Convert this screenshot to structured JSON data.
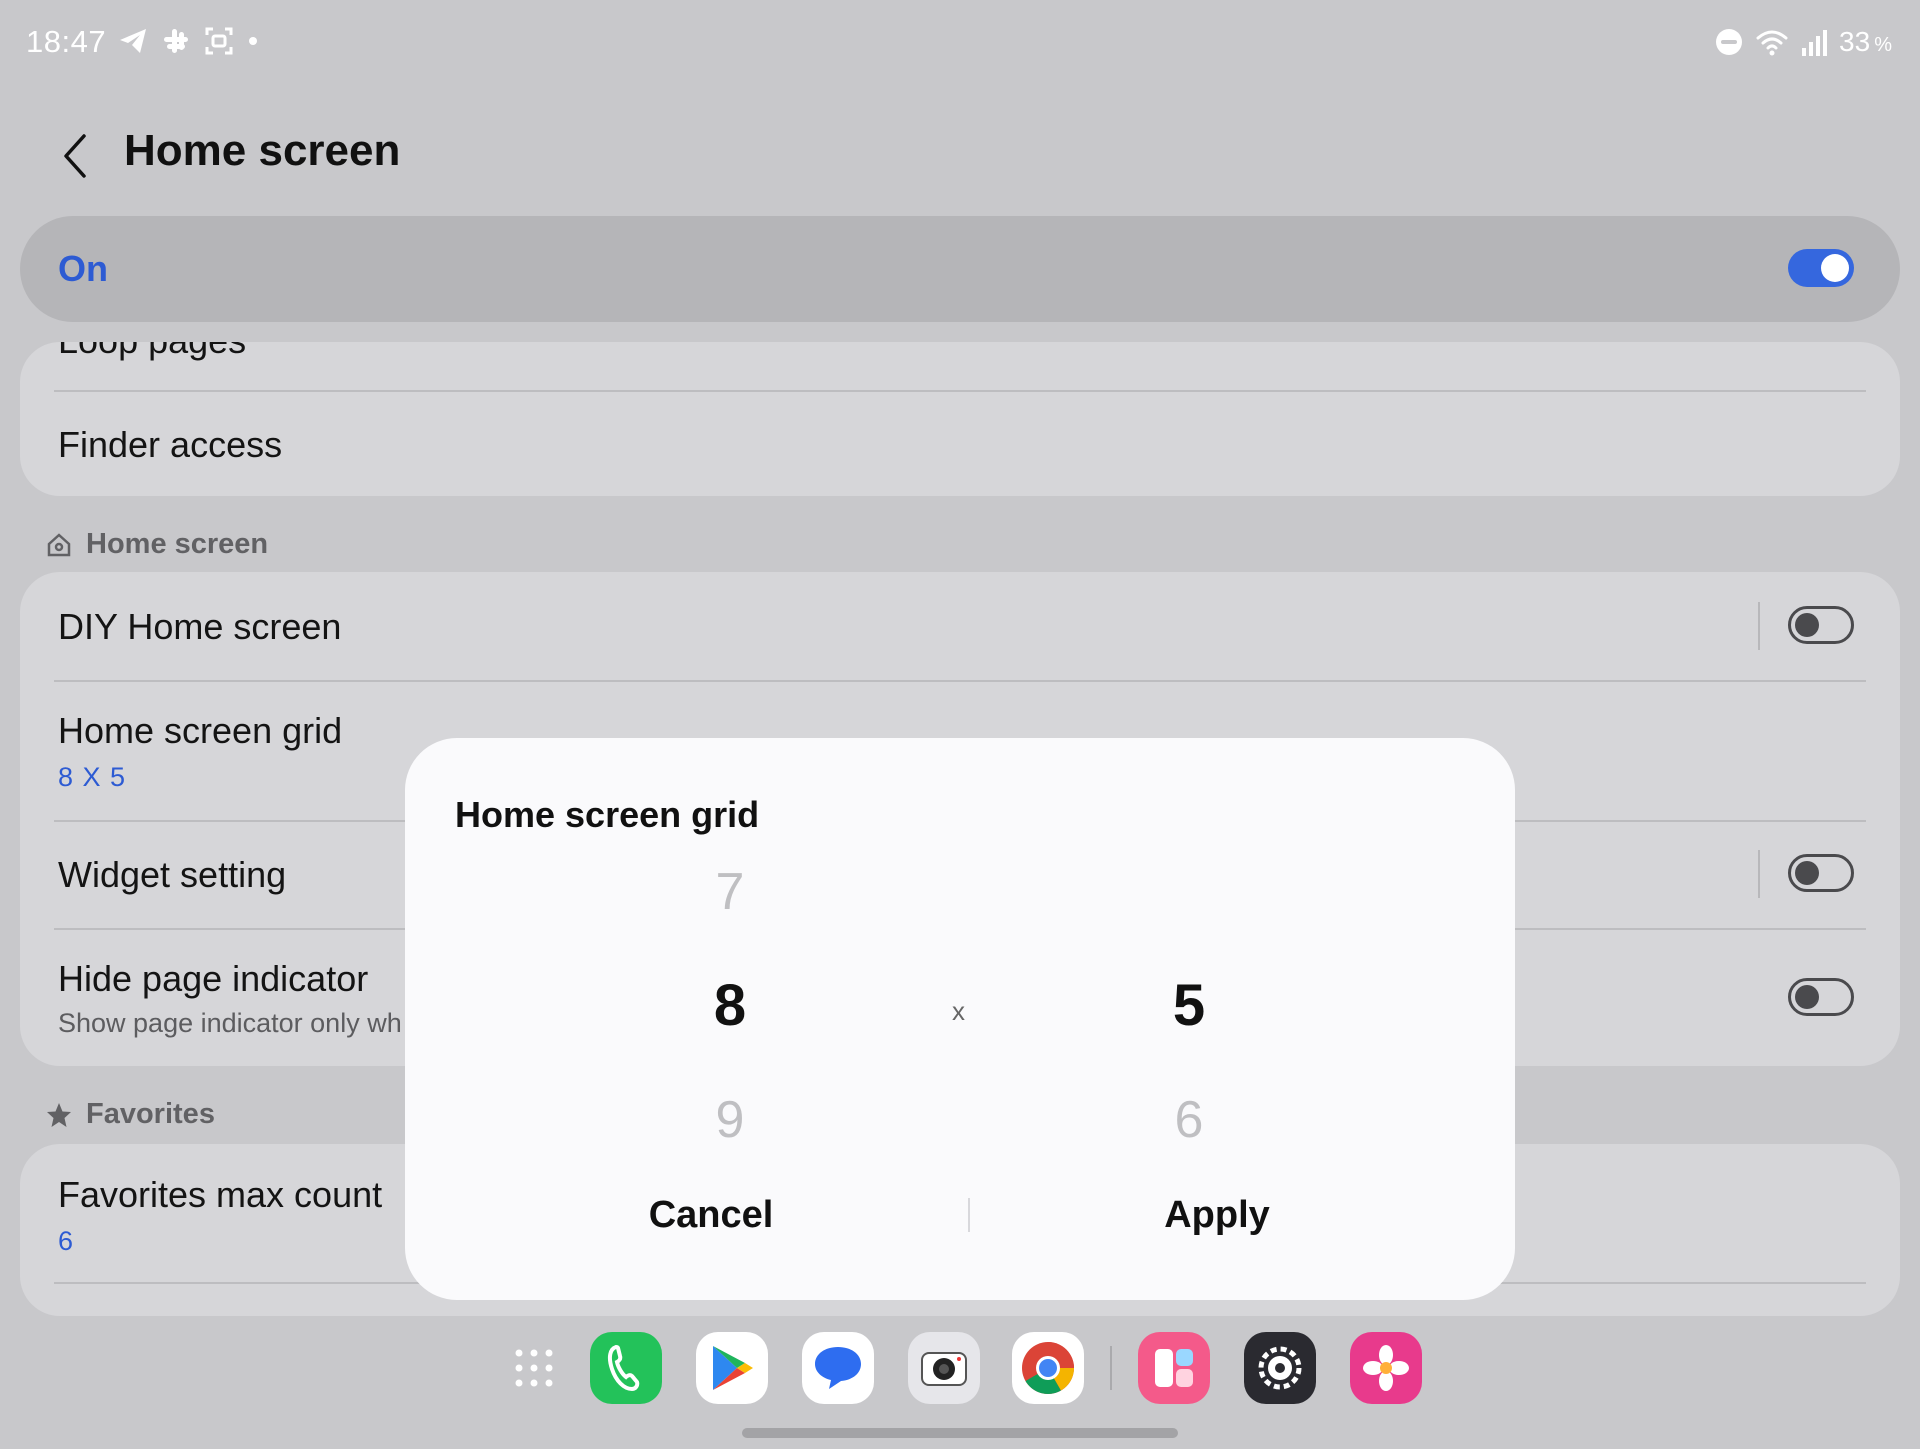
{
  "status_bar": {
    "time": "18:47",
    "battery": "33",
    "battery_unit": "%",
    "icons": [
      "telegram-icon",
      "slack-icon",
      "screenshot-icon",
      "dot-icon",
      "dnd-icon",
      "wifi-icon",
      "signal-icon"
    ]
  },
  "header": {
    "title": "Home screen"
  },
  "master": {
    "label": "On",
    "enabled": true
  },
  "group1": {
    "partial_item": "Loop pages",
    "finder": "Finder access"
  },
  "section_home": {
    "title": "Home screen"
  },
  "home_items": {
    "diy": "DIY Home screen",
    "grid_label": "Home screen grid",
    "grid_value": "8 X 5",
    "widget": "Widget setting",
    "hide_indicator": "Hide page indicator",
    "hide_indicator_desc": "Show page indicator only wh"
  },
  "section_favorites": {
    "title": "Favorites"
  },
  "favorites": {
    "max_label": "Favorites max count",
    "max_value": "6"
  },
  "dialog": {
    "title": "Home screen grid",
    "rows": {
      "prev": "7",
      "selected": "8",
      "next": "9"
    },
    "separator": "x",
    "cols": {
      "prev": "",
      "selected": "5",
      "next": "6"
    },
    "cancel": "Cancel",
    "apply": "Apply"
  },
  "dock": {
    "apps": [
      "app-drawer-icon",
      "phone-icon",
      "play-store-icon",
      "messages-icon",
      "camera-icon",
      "chrome-icon",
      "multi-window-icon",
      "settings-icon",
      "gallery-icon"
    ]
  },
  "colors": {
    "accent": "#3567de",
    "accent_text": "#2d5bd3",
    "background": "#c8c8cb",
    "card": "#d6d6d9",
    "dialog": "#fafafc"
  }
}
